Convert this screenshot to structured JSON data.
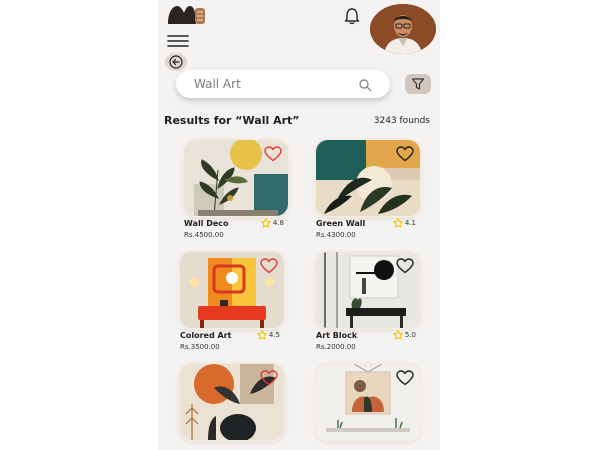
{
  "colors": {
    "screen_bg": "#f5f3f1",
    "accent_brown": "#8c4b27",
    "heart_red": "#e53935",
    "star_yellow": "#f2c200",
    "filter_bg": "#d2c7bf"
  },
  "header": {
    "logo_icon": "brand-logo",
    "notification_icon": "bell-icon",
    "avatar_icon": "user-avatar",
    "menu_icon": "hamburger-icon",
    "back_icon": "back-arrow-icon"
  },
  "search": {
    "value": "Wall Art",
    "icon": "search-icon",
    "filter_icon": "filter-icon"
  },
  "results": {
    "title": "Results for “Wall Art”",
    "count": "3243 founds"
  },
  "products": [
    {
      "name": "Wall Deco",
      "rating": "4.8",
      "price": "Rs.4500.00",
      "heart_color": "#e53935"
    },
    {
      "name": "Green Wall",
      "rating": "4.1",
      "price": "Rs.4300.00",
      "heart_color": "#1f1f1f"
    },
    {
      "name": "Colored Art",
      "rating": "4.5",
      "price": "Rs.3500.00",
      "heart_color": "#e53935"
    },
    {
      "name": "Art Block",
      "rating": "5.0",
      "price": "Rs.2000.00",
      "heart_color": "#1f1f1f"
    },
    {
      "name": "",
      "rating": "",
      "price": "",
      "heart_color": "#e53935"
    },
    {
      "name": "",
      "rating": "",
      "price": "",
      "heart_color": "#1f1f1f"
    }
  ]
}
